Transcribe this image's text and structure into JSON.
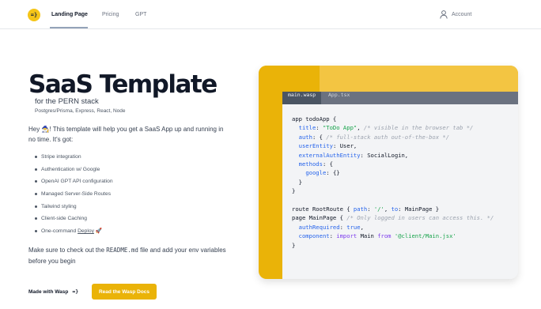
{
  "header": {
    "logo_text": "=}",
    "nav": [
      "Landing Page",
      "Pricing",
      "GPT"
    ],
    "account_label": "Account"
  },
  "hero": {
    "title": "SaaS Template",
    "subtitle": "for the PERN stack",
    "stack": "Postgres/Prisma, Express, React, Node",
    "intro_before_emoji": "Hey ",
    "intro_emoji": "🧙‍♂️",
    "intro_after_emoji": "! This template will help you get a SaaS App up and running in no time. It's got:",
    "features": [
      "Stripe integration",
      "Authentication w/ Google",
      "OpenAI GPT API configuration",
      "Managed Server-Side Routes",
      "Tailwind styling",
      "Client-side Caching"
    ],
    "last_feature_prefix": "One-command ",
    "last_feature_link": "Deploy",
    "last_feature_emoji": "🚀",
    "outro_before": "Make sure to check out the ",
    "outro_code": "README.md",
    "outro_after": " file and add your env variables before you begin",
    "made_with": "Made with Wasp",
    "made_with_mark": "=}",
    "docs_button": "Read the Wasp Docs"
  },
  "code_card": {
    "tabs": [
      "main.wasp",
      "App.tsx"
    ],
    "active_tab": "main.wasp",
    "code": {
      "l1": "app todoApp {",
      "l2_key": "title",
      "l2_val": "\"ToDo App\"",
      "l2_comment": "/* visible in the browser tab */",
      "l3_key": "auth",
      "l3_comment": "/* full-stack auth out-of-the-box */",
      "l4_key": "userEntity",
      "l4_val": "User,",
      "l5_key": "externalAuthEntity",
      "l5_val": "SocialLogin,",
      "l6_key": "methods",
      "l7_key": "google",
      "l7_val": "{}",
      "l8": "}",
      "l9": "}",
      "l10_a": "route RootRoute { ",
      "l10_k1": "path",
      "l10_v1": "'/'",
      "l10_k2": "to",
      "l10_b": "MainPage }",
      "l11_a": "page MainPage { ",
      "l11_comment": "/* Only logged in users can access this. */",
      "l12_key": "authRequired",
      "l12_val": "true",
      "l13_key": "component",
      "l13_imp": "import",
      "l13_mid": "Main",
      "l13_from": "from",
      "l13_val": "'@client/Main.jsx'",
      "l14": "}"
    }
  },
  "colors": {
    "accent": "#eab308",
    "accent_light": "#f3c542",
    "code_bg": "#f3f4f6",
    "tab_bar": "#6b7280"
  }
}
